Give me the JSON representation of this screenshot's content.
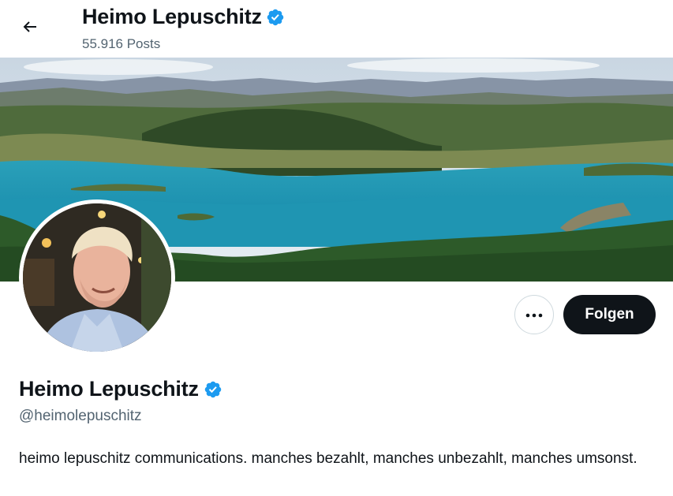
{
  "header": {
    "name": "Heimo Lepuschitz",
    "posts_count": "55.916 Posts"
  },
  "icons": {
    "back": "arrow-left-icon",
    "verified": "verified-badge-icon",
    "more": "more-horizontal-icon"
  },
  "colors": {
    "verified_blue": "#1d9bf0",
    "follow_button_bg": "#0f1419",
    "secondary_text": "#536471"
  },
  "profile": {
    "name": "Heimo Lepuschitz",
    "handle": "@heimolepuschitz",
    "bio": "heimo lepuschitz communications. manches bezahlt, manches unbezahlt, manches umsonst."
  },
  "actions": {
    "follow_label": "Folgen"
  }
}
